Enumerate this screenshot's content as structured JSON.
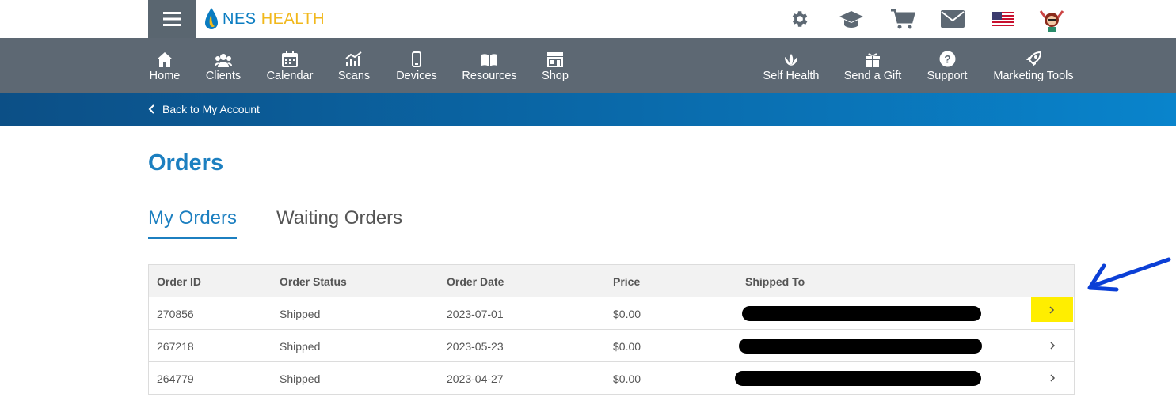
{
  "brand": {
    "name_part1": "NES",
    "name_part2": "HEALTH"
  },
  "top_icons": [
    "gear-icon",
    "graduation-cap-icon",
    "cart-icon",
    "mail-icon",
    "us-flag-icon",
    "avatar"
  ],
  "nav": [
    {
      "label": "Home",
      "icon": "home-icon"
    },
    {
      "label": "Clients",
      "icon": "users-icon"
    },
    {
      "label": "Calendar",
      "icon": "calendar-icon"
    },
    {
      "label": "Scans",
      "icon": "chart-icon"
    },
    {
      "label": "Devices",
      "icon": "phone-icon"
    },
    {
      "label": "Resources",
      "icon": "book-icon"
    },
    {
      "label": "Shop",
      "icon": "store-icon"
    },
    {
      "label": "Self Health",
      "icon": "lotus-icon"
    },
    {
      "label": "Send a Gift",
      "icon": "gift-icon"
    },
    {
      "label": "Support",
      "icon": "question-icon"
    },
    {
      "label": "Marketing Tools",
      "icon": "rocket-icon"
    }
  ],
  "back_link": "Back to My Account",
  "page_title": "Orders",
  "tabs": [
    {
      "label": "My Orders",
      "active": true
    },
    {
      "label": "Waiting Orders",
      "active": false
    }
  ],
  "table": {
    "headers": [
      "Order ID",
      "Order Status",
      "Order Date",
      "Price",
      "Shipped To"
    ],
    "rows": [
      {
        "id": "270856",
        "status": "Shipped",
        "date": "2023-07-01",
        "price": "$0.00"
      },
      {
        "id": "267218",
        "status": "Shipped",
        "date": "2023-05-23",
        "price": "$0.00"
      },
      {
        "id": "264779",
        "status": "Shipped",
        "date": "2023-04-27",
        "price": "$0.00"
      }
    ]
  },
  "colors": {
    "accent": "#1c7fc0",
    "nav_bg": "#5d6873",
    "highlight": "#ffee00",
    "annotation_arrow": "#0b3fd6"
  }
}
